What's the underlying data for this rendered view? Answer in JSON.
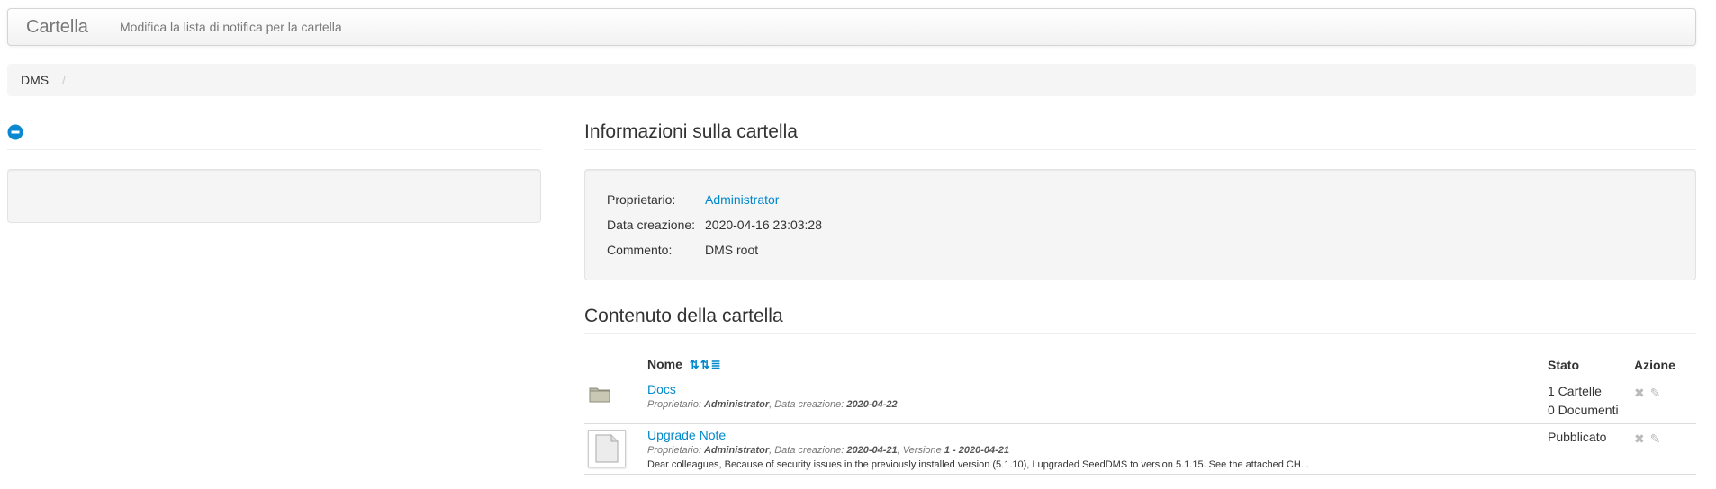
{
  "navbar": {
    "brand": "Cartella",
    "link": "Modifica la lista di notifica per la cartella"
  },
  "breadcrumb": {
    "items": [
      "DMS"
    ],
    "divider": "/"
  },
  "sidebar": {
    "collapse_icon": "minus-circle-icon"
  },
  "folder_info": {
    "heading": "Informazioni sulla cartella",
    "rows": [
      {
        "label": "Proprietario:",
        "value": "Administrator"
      },
      {
        "label": "Data creazione:",
        "value": "2020-04-16 23:03:28"
      },
      {
        "label": "Commento:",
        "value": "DMS root"
      }
    ]
  },
  "folder_content": {
    "heading": "Contenuto della cartella",
    "columns": {
      "name": "Nome",
      "status": "Stato",
      "action": "Azione"
    },
    "sort_icons": [
      "sort-alpha-asc-icon",
      "sort-numeric-asc-icon",
      "sort-amount-asc-icon"
    ],
    "rows": [
      {
        "type": "folder",
        "name": "Docs",
        "owner_label": "Proprietario:",
        "owner": "Administrator",
        "date_label": "Data creazione:",
        "date": "2020-04-22",
        "status_lines": [
          "1 Cartelle",
          "0 Documenti"
        ]
      },
      {
        "type": "document",
        "name": "Upgrade Note",
        "owner_label": "Proprietario:",
        "owner": "Administrator",
        "date_label": "Data creazione:",
        "date": "2020-04-21",
        "version_label": "Versione",
        "version": "1 - 2020-04-21",
        "description": "Dear colleagues, Because of security issues in the previously installed version (5.1.10), I upgraded SeedDMS to version 5.1.15. See the attached CH...",
        "status_lines": [
          "Pubblicato"
        ]
      }
    ]
  },
  "colors": {
    "link": "#0088cc",
    "muted": "#777777"
  }
}
